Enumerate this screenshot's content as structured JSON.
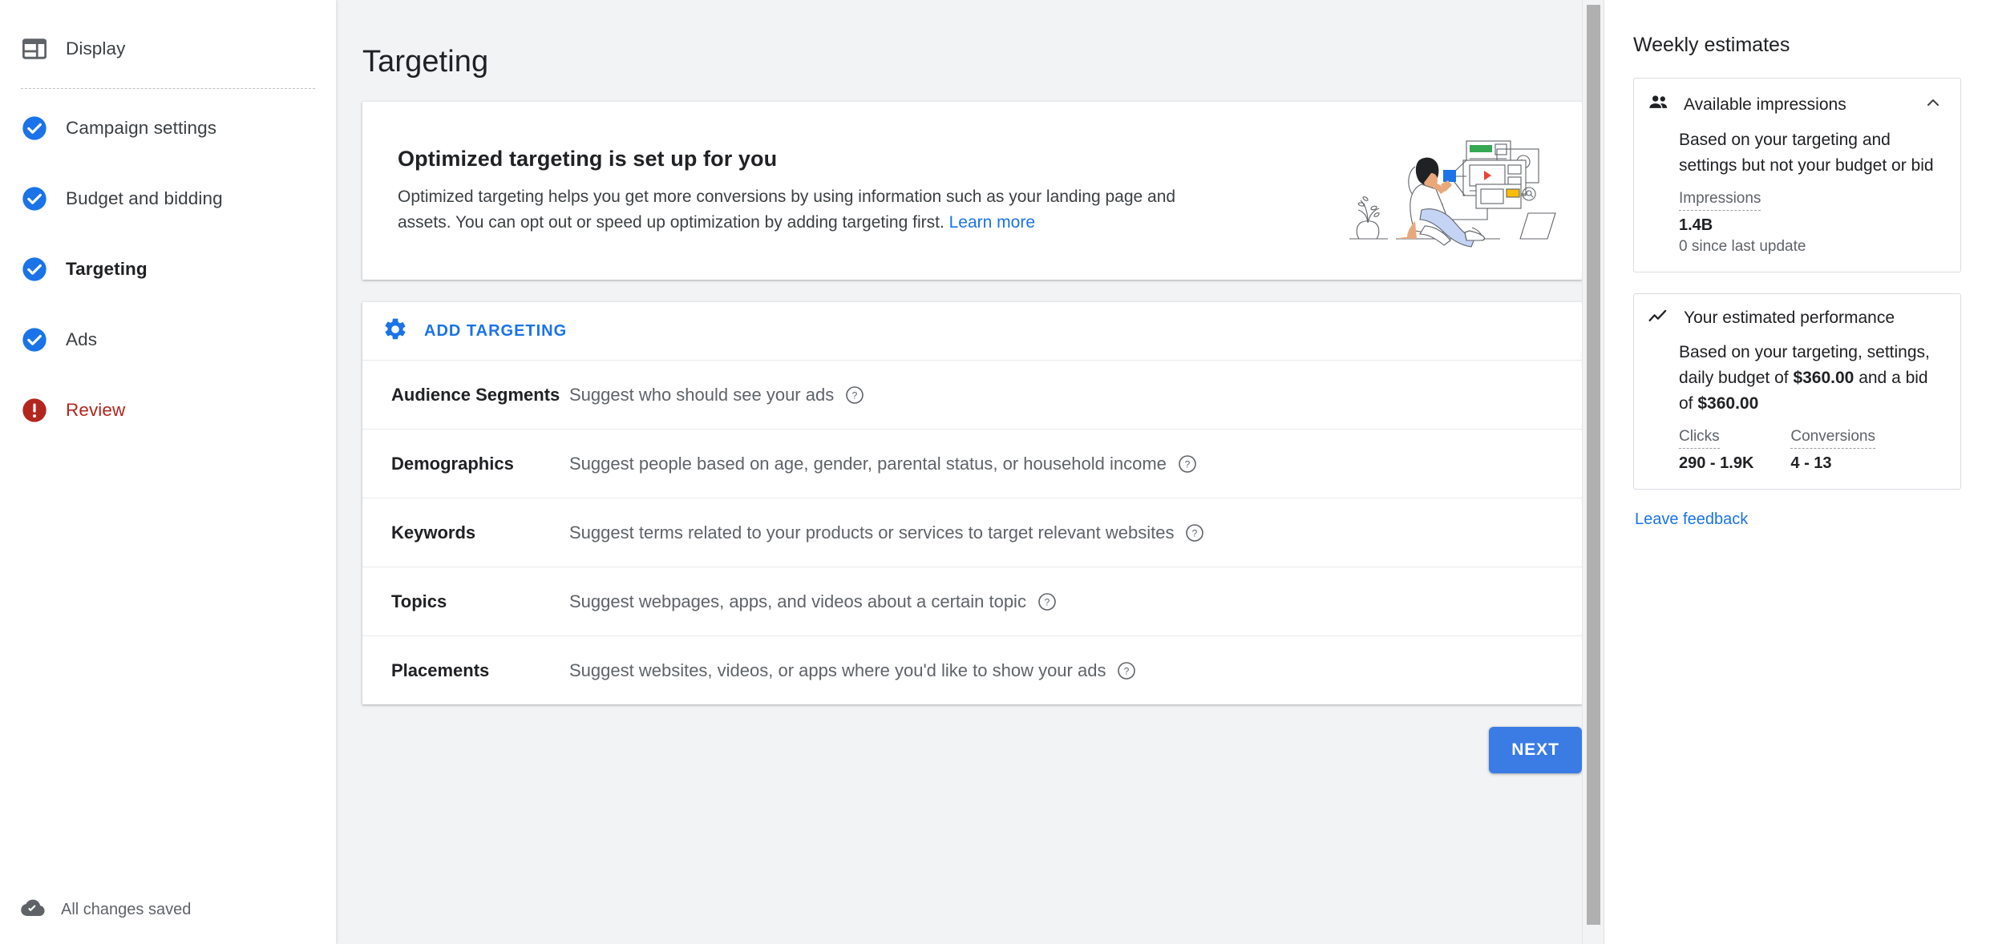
{
  "sidebar": {
    "top_item": {
      "label": "Display",
      "icon": "display-layout-icon"
    },
    "items": [
      {
        "label": "Campaign settings",
        "icon": "check-circle-icon",
        "state": "complete"
      },
      {
        "label": "Budget and bidding",
        "icon": "check-circle-icon",
        "state": "complete"
      },
      {
        "label": "Targeting",
        "icon": "check-circle-icon",
        "state": "current"
      },
      {
        "label": "Ads",
        "icon": "check-circle-icon",
        "state": "complete"
      },
      {
        "label": "Review",
        "icon": "error-circle-icon",
        "state": "error"
      }
    ],
    "save_status": {
      "label": "All changes saved",
      "icon": "cloud-done-icon"
    }
  },
  "main": {
    "page_title": "Targeting",
    "promo": {
      "title": "Optimized targeting is set up for you",
      "body": "Optimized targeting helps you get more conversions by using information such as your landing page and assets. You can opt out or speed up optimization by adding targeting first.",
      "link_label": "Learn more",
      "illustration": "person-with-ad-formats-illustration"
    },
    "add_targeting": {
      "label": "ADD TARGETING",
      "icon": "gear-icon"
    },
    "targeting_rows": [
      {
        "name": "Audience Segments",
        "description": "Suggest who should see your ads",
        "help_icon": "help-circle-icon"
      },
      {
        "name": "Demographics",
        "description": "Suggest people based on age, gender, parental status, or household income",
        "help_icon": "help-circle-icon"
      },
      {
        "name": "Keywords",
        "description": "Suggest terms related to your products or services to target relevant websites",
        "help_icon": "help-circle-icon"
      },
      {
        "name": "Topics",
        "description": "Suggest webpages, apps, and videos about a certain topic",
        "help_icon": "help-circle-icon"
      },
      {
        "name": "Placements",
        "description": "Suggest websites, videos, or apps where you'd like to show your ads",
        "help_icon": "help-circle-icon"
      }
    ],
    "next_button": "NEXT"
  },
  "right_panel": {
    "title": "Weekly estimates",
    "available_impressions": {
      "heading": "Available impressions",
      "heading_icon": "people-icon",
      "collapse_icon": "chevron-up-icon",
      "description": "Based on your targeting and settings but not your budget or bid",
      "metric_label": "Impressions",
      "metric_value": "1.4B",
      "metric_sub": "0 since last update"
    },
    "estimated_performance": {
      "heading": "Your estimated performance",
      "heading_icon": "trending-up-icon",
      "description_pre": "Based on your targeting, settings, daily budget of ",
      "budget": "$360.00",
      "description_mid": " and a bid of ",
      "bid": "$360.00",
      "metrics": [
        {
          "label": "Clicks",
          "value": "290 - 1.9K"
        },
        {
          "label": "Conversions",
          "value": "4 - 13"
        }
      ]
    },
    "feedback_link": "Leave feedback"
  },
  "colors": {
    "accent_blue": "#1a73e8",
    "button_blue": "#3c7de4",
    "error_red": "#b3261e",
    "check_blue": "#1a73e8",
    "page_bg": "#f1f3f4",
    "text_primary": "#202124",
    "text_secondary": "#5f6368"
  }
}
